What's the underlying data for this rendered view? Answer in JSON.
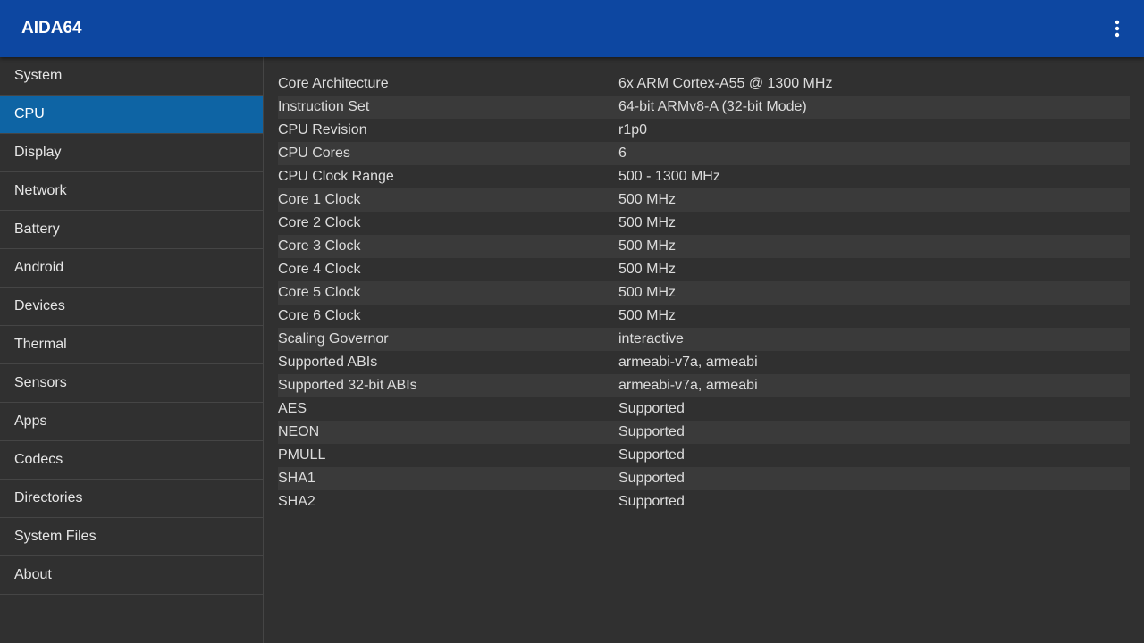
{
  "app": {
    "title": "AIDA64",
    "accent": "#0D47A1",
    "selected_color": "#0E64A4"
  },
  "sidebar": {
    "items": [
      {
        "label": "System",
        "active": false
      },
      {
        "label": "CPU",
        "active": true
      },
      {
        "label": "Display",
        "active": false
      },
      {
        "label": "Network",
        "active": false
      },
      {
        "label": "Battery",
        "active": false
      },
      {
        "label": "Android",
        "active": false
      },
      {
        "label": "Devices",
        "active": false
      },
      {
        "label": "Thermal",
        "active": false
      },
      {
        "label": "Sensors",
        "active": false
      },
      {
        "label": "Apps",
        "active": false
      },
      {
        "label": "Codecs",
        "active": false
      },
      {
        "label": "Directories",
        "active": false
      },
      {
        "label": "System Files",
        "active": false
      },
      {
        "label": "About",
        "active": false
      }
    ]
  },
  "cpu_info": [
    {
      "label": "Core Architecture",
      "value": "6x ARM Cortex-A55 @ 1300 MHz"
    },
    {
      "label": "Instruction Set",
      "value": "64-bit ARMv8-A (32-bit Mode)"
    },
    {
      "label": "CPU Revision",
      "value": "r1p0"
    },
    {
      "label": "CPU Cores",
      "value": "6"
    },
    {
      "label": "CPU Clock Range",
      "value": "500 - 1300 MHz"
    },
    {
      "label": "Core 1 Clock",
      "value": "500 MHz"
    },
    {
      "label": "Core 2 Clock",
      "value": "500 MHz"
    },
    {
      "label": "Core 3 Clock",
      "value": "500 MHz"
    },
    {
      "label": "Core 4 Clock",
      "value": "500 MHz"
    },
    {
      "label": "Core 5 Clock",
      "value": "500 MHz"
    },
    {
      "label": "Core 6 Clock",
      "value": "500 MHz"
    },
    {
      "label": "Scaling Governor",
      "value": "interactive"
    },
    {
      "label": "Supported ABIs",
      "value": "armeabi-v7a, armeabi"
    },
    {
      "label": "Supported 32-bit ABIs",
      "value": "armeabi-v7a, armeabi"
    },
    {
      "label": "AES",
      "value": "Supported"
    },
    {
      "label": "NEON",
      "value": "Supported"
    },
    {
      "label": "PMULL",
      "value": "Supported"
    },
    {
      "label": "SHA1",
      "value": "Supported"
    },
    {
      "label": "SHA2",
      "value": "Supported"
    }
  ],
  "icons": {
    "overflow": "more-vertical-icon"
  }
}
